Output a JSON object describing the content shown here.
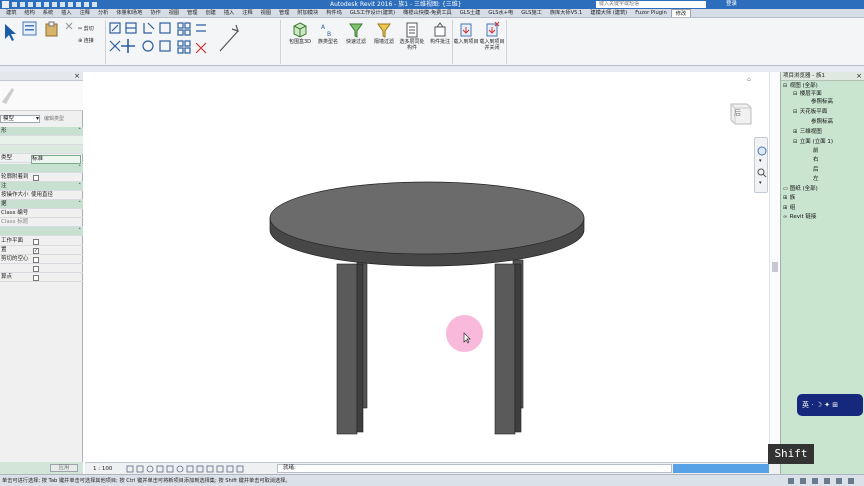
{
  "window": {
    "title": "Autodesk Revit 2016 -  族1 - 三维视图: {三维}",
    "search_placeholder": "键入关键字或短语",
    "login_label": "登录"
  },
  "ribbon_tabs": [
    {
      "label": "建筑"
    },
    {
      "label": "结构"
    },
    {
      "label": "系统"
    },
    {
      "label": "插入"
    },
    {
      "label": "注释"
    },
    {
      "label": "分析"
    },
    {
      "label": "体量和场地"
    },
    {
      "label": "协作"
    },
    {
      "label": "视图"
    },
    {
      "label": "管理"
    },
    {
      "label": "创建"
    },
    {
      "label": "插入"
    },
    {
      "label": "注释"
    },
    {
      "label": "视图"
    },
    {
      "label": "管理"
    },
    {
      "label": "附加模块"
    },
    {
      "label": "构件坞"
    },
    {
      "label": "GLS工作设计(建筑)"
    },
    {
      "label": "橄榄山快模-免费工具"
    },
    {
      "label": "GLS土建"
    },
    {
      "label": "GLS水+电"
    },
    {
      "label": "GLS施工"
    },
    {
      "label": "族库大师V5.1"
    },
    {
      "label": "建模大师 (建筑)"
    },
    {
      "label": "Fuzor Plugin"
    },
    {
      "label": "修改"
    }
  ],
  "ribbon": {
    "clipboard": {
      "cut_label": "剪切",
      "join_label": "连接"
    },
    "buttons": [
      {
        "label": "包围盒3D"
      },
      {
        "label": "族类型名"
      },
      {
        "label": "快速过滤"
      },
      {
        "label": "隔墙过滤"
      },
      {
        "label": "选多层同处构件"
      },
      {
        "label": "构件批注"
      },
      {
        "label": "载入到项目"
      },
      {
        "label": "载入到项目并关闭"
      }
    ]
  },
  "properties": {
    "type_selector": "模型",
    "edit_type_label": "编辑类型",
    "rows": [
      {
        "key": "形",
        "value": "",
        "section": true
      },
      {
        "key": "类型",
        "value": "标准",
        "section": false
      },
      {
        "key": "",
        "value": "",
        "section": true
      },
      {
        "key": "轮廓附着到",
        "value": "",
        "section": false,
        "checkbox": true
      },
      {
        "key": "注",
        "value": "",
        "section": true
      },
      {
        "key": "按操作大小",
        "value": "使用直径",
        "section": false
      },
      {
        "key": "据",
        "value": "",
        "section": true
      },
      {
        "key": "Class 编号",
        "value": "",
        "section": false
      },
      {
        "key": "Class 标题",
        "value": "",
        "section": false,
        "greyed": true
      },
      {
        "key": "",
        "value": "",
        "section": true
      },
      {
        "key": "工作平面",
        "value": "",
        "section": false,
        "checkbox": true
      },
      {
        "key": "置",
        "value": "",
        "section": false,
        "checkbox": true
      },
      {
        "key": "剪切的空心",
        "value": "",
        "section": false,
        "checkbox": true
      },
      {
        "key": "",
        "value": "",
        "section": false
      },
      {
        "key": "算点",
        "value": "",
        "section": false,
        "checkbox": true
      }
    ],
    "apply_label": "应用"
  },
  "canvas": {
    "viewcube_face": "后",
    "scale_label": "1 : 100",
    "hscroll_label": "就绪:"
  },
  "project_browser": {
    "title": "项目浏览器 - 族1",
    "items": [
      {
        "label": "视图 (全部)",
        "toggle": "⊟"
      },
      {
        "label": "楼层平面",
        "toggle": "⊟"
      },
      {
        "label": "参照标高",
        "toggle": ""
      },
      {
        "label": "天花板平面",
        "toggle": "⊟"
      },
      {
        "label": "参照标高",
        "toggle": ""
      },
      {
        "label": "三维视图",
        "toggle": "⊞"
      },
      {
        "label": "立面 (立面 1)",
        "toggle": "⊟"
      },
      {
        "label": "前",
        "toggle": ""
      },
      {
        "label": "右",
        "toggle": ""
      },
      {
        "label": "后",
        "toggle": ""
      },
      {
        "label": "左",
        "toggle": ""
      },
      {
        "label": "图纸 (全部)",
        "toggle": ""
      },
      {
        "label": "族",
        "toggle": "⊞"
      },
      {
        "label": "组",
        "toggle": "⊞"
      },
      {
        "label": "Revit 链接",
        "toggle": ""
      }
    ],
    "ime_text": "英 · ☽ ✦ ⊞"
  },
  "status": {
    "text": "单击可进行选择; 按 Tab 键并单击可选择其他项目; 按 Ctrl 键并单击可将新项目添加到选择集; 按 Shift 键并单击可取消选择。"
  },
  "overlay": {
    "key_label": "Shift"
  },
  "colors": {
    "titlebar": "#2d6ebc",
    "section_green": "#c7e0cf",
    "browser_bg": "#c9e4cf",
    "table_gray": "#6b6b6b",
    "cursor_pink": "#f7b1d7"
  }
}
